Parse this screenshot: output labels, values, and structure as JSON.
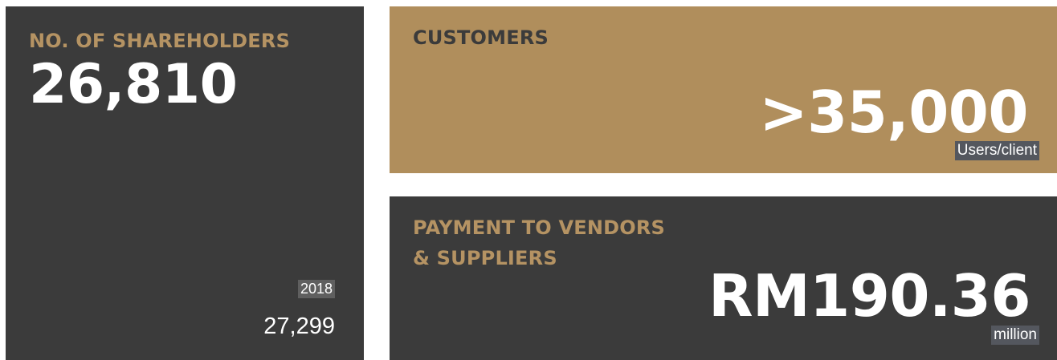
{
  "shareholders": {
    "label": "NO. OF SHAREHOLDERS",
    "value": "26,810",
    "prior_year": "2018",
    "prior_value": "27,299"
  },
  "customers": {
    "label": "CUSTOMERS",
    "value": ">35,000",
    "unit": "Users/client"
  },
  "payment": {
    "label_line1": "PAYMENT TO VENDORS",
    "label_line2": "& SUPPLIERS",
    "value": "RM190.36",
    "unit": "million"
  },
  "colors": {
    "dark_tile": "#3b3b3b",
    "gold_tile": "#b08e5c",
    "gold_text": "#b59363",
    "value_text": "#ffffff"
  }
}
